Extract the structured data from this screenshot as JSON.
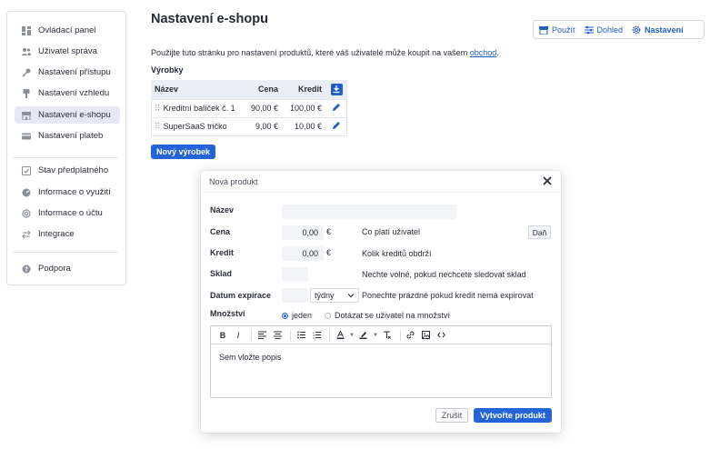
{
  "sidebar": {
    "items": [
      {
        "label": "Ovládací panel",
        "icon": "dashboard-icon"
      },
      {
        "label": "Uživatel správa",
        "icon": "users-icon"
      },
      {
        "label": "Nastavení přístupu",
        "icon": "key-icon"
      },
      {
        "label": "Nastavení vzhledu",
        "icon": "brush-icon"
      },
      {
        "label": "Nastavení e-shopu",
        "icon": "shop-icon",
        "active": true
      },
      {
        "label": "Nastavení plateb",
        "icon": "card-icon"
      },
      {
        "label": "Stav předplatného",
        "icon": "check-square-icon"
      },
      {
        "label": "Informace o využití",
        "icon": "gauge-icon"
      },
      {
        "label": "Informace o účtu",
        "icon": "at-icon"
      },
      {
        "label": "Integrace",
        "icon": "arrows-icon"
      },
      {
        "label": "Podpora",
        "icon": "help-icon"
      }
    ]
  },
  "header": {
    "title": "Nastavení e-shopu",
    "nav": {
      "use": "Použít",
      "supervise": "Dohled",
      "settings": "Nastavení"
    }
  },
  "intro": {
    "text_before": "Použijte tuto stránku pro nastavení produktů, které váš uživatelé může koupit na vašem ",
    "link": "obchod",
    "text_after": "."
  },
  "products": {
    "section_label": "Výrobky",
    "columns": {
      "name": "Název",
      "price": "Cena",
      "credit": "Kredit"
    },
    "rows": [
      {
        "name": "Kreditní balíček č. 1",
        "price": "90,00 €",
        "credit": "100,00 €"
      },
      {
        "name": "SuperSaaS tričko",
        "price": "9,00 €",
        "credit": "10,00 €"
      }
    ],
    "new_button": "Nový výrobek"
  },
  "modal": {
    "title": "Nová produkt",
    "fields": {
      "name_label": "Název",
      "name_value": "",
      "price_label": "Cena",
      "price_value": "0,00",
      "price_unit": "€",
      "price_help": "Co platí uživatel",
      "tax_button": "Daň",
      "credit_label": "Kredit",
      "credit_value": "0,00",
      "credit_unit": "€",
      "credit_help": "Kolik kreditů obdrží",
      "stock_label": "Sklad",
      "stock_value": "",
      "stock_help": "Nechte volné, pokud nechcete sledovat sklad",
      "expiry_label": "Datum expirace",
      "expiry_value": "",
      "expiry_unit": "týdny",
      "expiry_help": "Ponechte prázdné pokud kredit nemá expirovat",
      "quantity_label": "Množství",
      "quantity_option_one": "jeden",
      "quantity_option_ask": "Dotázat se uživatel na množství"
    },
    "editor": {
      "placeholder_text": "Sem vložte popis"
    },
    "cancel": "Zrušit",
    "create": "Vytvořte produkt"
  },
  "colors": {
    "accent": "#2563d9",
    "active_bg": "#e7e8f4",
    "table_header_bg": "#e9eef6"
  }
}
